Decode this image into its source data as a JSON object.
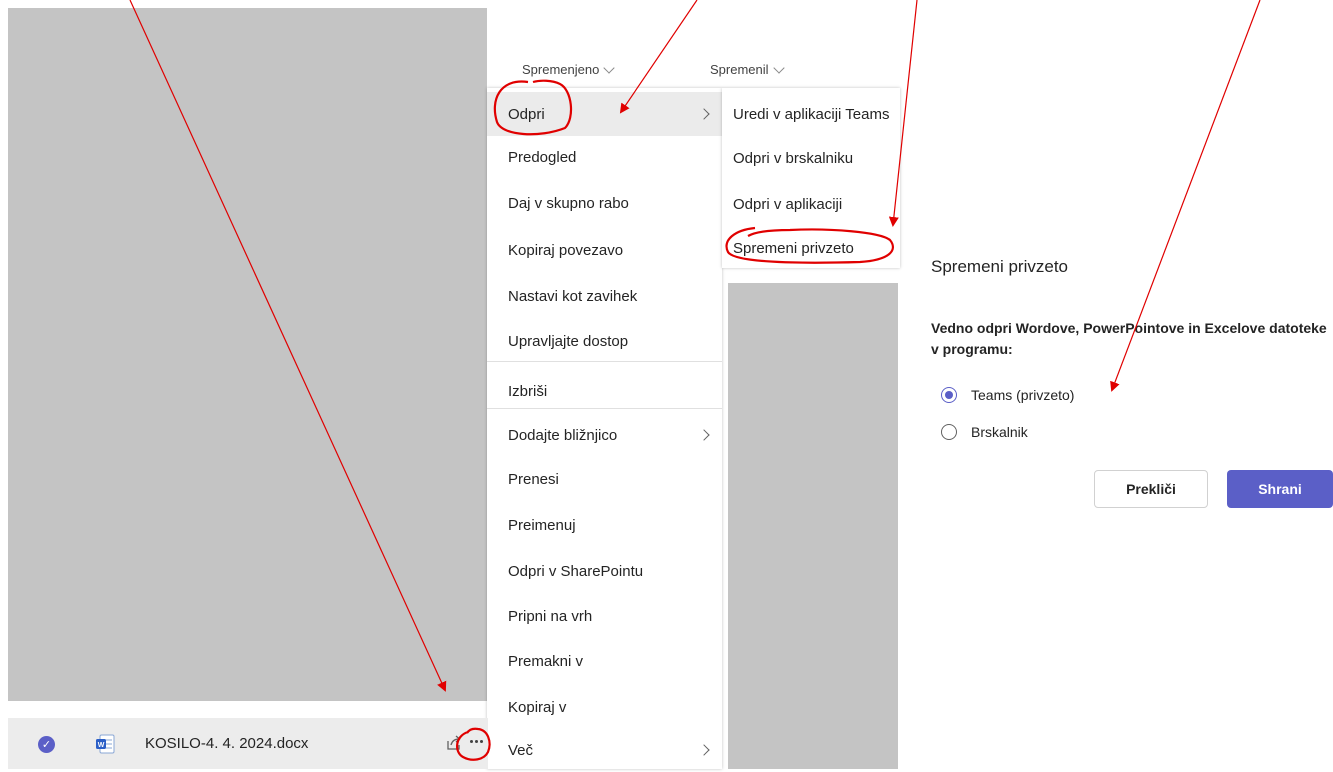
{
  "header": {
    "col_modified": "Spremenjeno",
    "col_modified_by": "Spremenil"
  },
  "context_menu": {
    "items": [
      {
        "label": "Odpri",
        "has_submenu": true
      },
      {
        "label": "Predogled"
      },
      {
        "label": "Daj v skupno rabo"
      },
      {
        "label": "Kopiraj povezavo"
      },
      {
        "label": "Nastavi kot zavihek"
      },
      {
        "label": "Upravljajte dostop"
      },
      {
        "label": "Izbriši"
      },
      {
        "label": "Dodajte bližnjico",
        "has_submenu": true
      },
      {
        "label": "Prenesi"
      },
      {
        "label": "Preimenuj"
      },
      {
        "label": "Odpri v SharePointu"
      },
      {
        "label": "Pripni na vrh"
      },
      {
        "label": "Premakni v"
      },
      {
        "label": "Kopiraj v"
      },
      {
        "label": "Več",
        "has_submenu": true
      }
    ]
  },
  "submenu": {
    "items": [
      {
        "label": "Uredi v aplikaciji Teams"
      },
      {
        "label": "Odpri v brskalniku"
      },
      {
        "label": "Odpri v aplikaciji"
      },
      {
        "label": "Spremeni privzeto"
      }
    ]
  },
  "dialog": {
    "title": "Spremeni privzeto",
    "question": "Vedno odpri Wordove, PowerPointove in Excelove datoteke v programu:",
    "options": [
      {
        "label": "Teams (privzeto)",
        "selected": true
      },
      {
        "label": "Brskalnik",
        "selected": false
      }
    ],
    "cancel_label": "Prekliči",
    "save_label": "Shrani"
  },
  "file_row": {
    "filename": "KOSILO-4. 4. 2024.docx",
    "file_type_icon": "word-icon",
    "selected": true
  },
  "colors": {
    "accent": "#5b5fc7",
    "annotation": "#e00000"
  }
}
